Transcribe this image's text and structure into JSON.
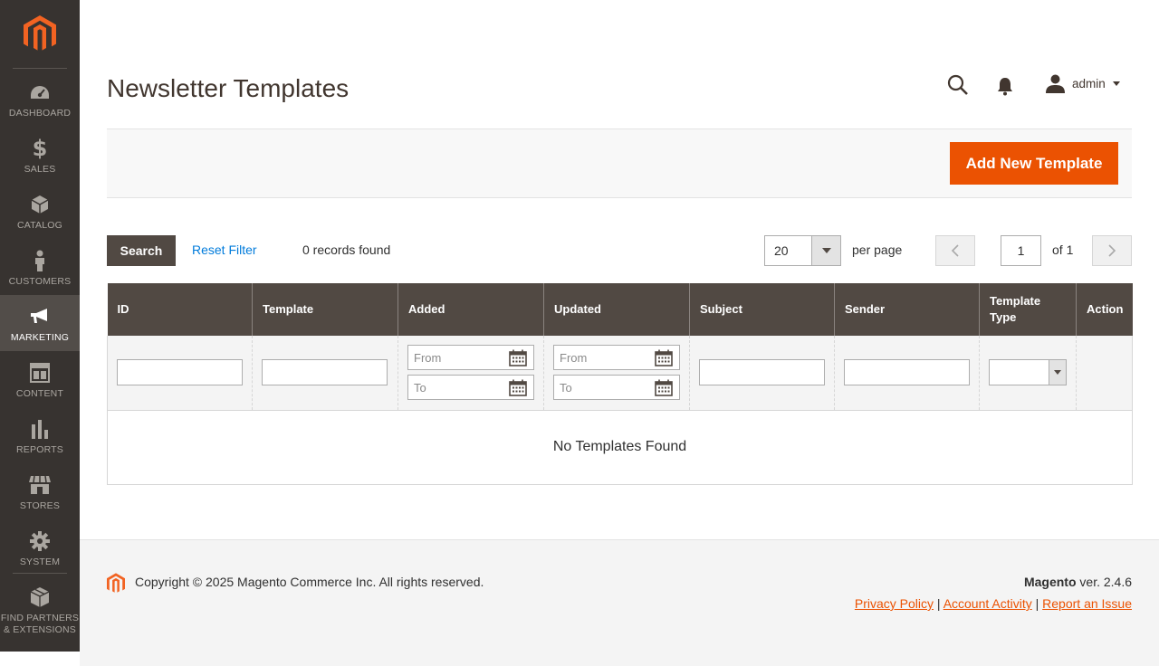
{
  "sidebar": {
    "logo": "magento-logo",
    "items": [
      {
        "label": "DASHBOARD",
        "icon": "dashboard-icon",
        "active": false
      },
      {
        "label": "SALES",
        "icon": "dollar-icon",
        "active": false
      },
      {
        "label": "CATALOG",
        "icon": "cube-icon",
        "active": false
      },
      {
        "label": "CUSTOMERS",
        "icon": "person-icon",
        "active": false
      },
      {
        "label": "MARKETING",
        "icon": "megaphone-icon",
        "active": true
      },
      {
        "label": "CONTENT",
        "icon": "layout-icon",
        "active": false
      },
      {
        "label": "REPORTS",
        "icon": "bar-chart-icon",
        "active": false
      },
      {
        "label": "STORES",
        "icon": "store-icon",
        "active": false
      },
      {
        "label": "SYSTEM",
        "icon": "gear-icon",
        "active": false
      },
      {
        "label_line1": "FIND PARTNERS",
        "label_line2": "& EXTENSIONS",
        "icon": "boxes-icon",
        "active": false
      }
    ]
  },
  "header": {
    "title": "Newsletter Templates",
    "user": "admin"
  },
  "actions": {
    "add_new": "Add New Template"
  },
  "toolbar": {
    "search": "Search",
    "reset_filter": "Reset Filter",
    "records": "0 records found",
    "per_page_value": "20",
    "per_page_label": "per page",
    "page": "1",
    "of_pages": "of 1"
  },
  "grid": {
    "columns": [
      "ID",
      "Template",
      "Added",
      "Updated",
      "Subject",
      "Sender",
      "Template Type",
      "Action"
    ],
    "date_from": "From",
    "date_to": "To",
    "empty_message": "No Templates Found"
  },
  "footer": {
    "copyright": "Copyright © 2025 Magento Commerce Inc. All rights reserved.",
    "brand": "Magento",
    "version": " ver. 2.4.6",
    "privacy": "Privacy Policy",
    "account_activity": "Account Activity",
    "report": "Report an Issue",
    "sep": "|"
  },
  "colors": {
    "sidebar_bg": "#373330",
    "accent": "#eb5202",
    "header_dark": "#514943",
    "link": "#007bdb"
  }
}
